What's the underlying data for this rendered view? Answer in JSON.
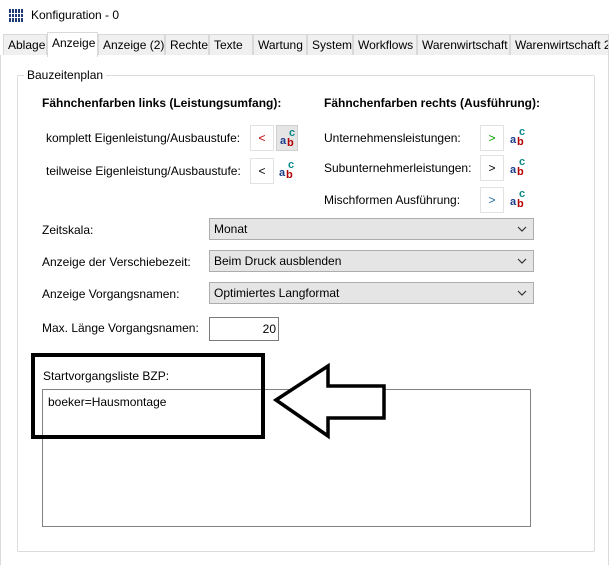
{
  "window": {
    "title": "Konfiguration - 0",
    "icon": "app-grid-icon"
  },
  "tabs": [
    {
      "label": "Ablage"
    },
    {
      "label": "Anzeige",
      "active": true
    },
    {
      "label": "Anzeige (2)"
    },
    {
      "label": "Rechte"
    },
    {
      "label": "Texte"
    },
    {
      "label": "Wartung"
    },
    {
      "label": "System"
    },
    {
      "label": "Workflows"
    },
    {
      "label": "Warenwirtschaft"
    },
    {
      "label": "Warenwirtschaft 2"
    }
  ],
  "group": {
    "title": "Bauzeitenplan",
    "left_header": "Fähnchenfarben links (Leistungsumfang):",
    "right_header": "Fähnchenfarben rechts (Ausführung):",
    "left_items": [
      {
        "label": "komplett Eigenleistung/Ausbaustufe:",
        "symbol": "<",
        "symbol_color": "#c00000"
      },
      {
        "label": "teilweise Eigenleistung/Ausbaustufe:",
        "symbol": "<",
        "symbol_color": "#000000"
      }
    ],
    "right_items": [
      {
        "label": "Unternehmensleistungen:",
        "symbol": ">",
        "symbol_color": "#00a000"
      },
      {
        "label": "Subunternehmerleistungen:",
        "symbol": ">",
        "symbol_color": "#000000"
      },
      {
        "label": "Mischformen Ausführung:",
        "symbol": ">",
        "symbol_color": "#1a6aa0"
      }
    ],
    "color_icon": "text-color-abc-icon",
    "zeitskala": {
      "label": "Zeitskala:",
      "value": "Monat"
    },
    "verschiebezeit": {
      "label": "Anzeige der Verschiebezeit:",
      "value": "Beim Druck ausblenden"
    },
    "vorgangsnamen": {
      "label": "Anzeige Vorgangsnamen:",
      "value": "Optimiertes Langformat"
    },
    "max_laenge": {
      "label": "Max. Länge Vorgangsnamen:",
      "value": "20"
    },
    "startliste": {
      "label": "Startvorgangsliste BZP:",
      "value": "boeker=Hausmontage"
    }
  }
}
